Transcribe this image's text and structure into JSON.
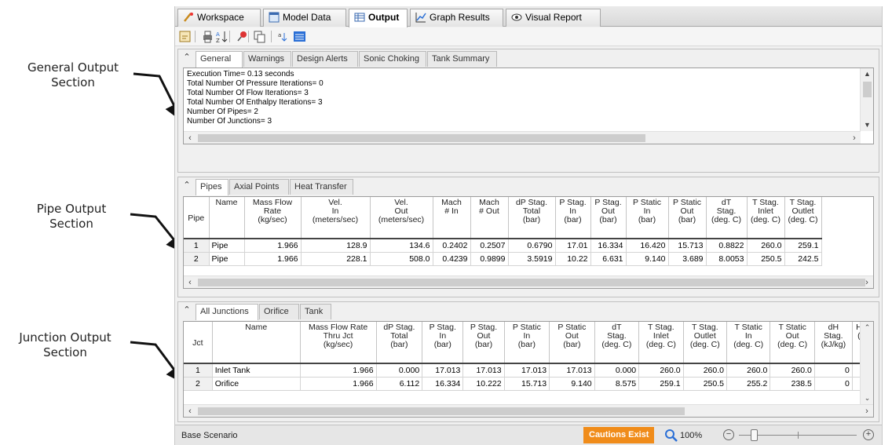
{
  "callouts": {
    "general": [
      "General Output",
      "Section"
    ],
    "pipe": [
      "Pipe Output",
      "Section"
    ],
    "junction": [
      "Junction Output",
      "Section"
    ]
  },
  "main_tabs": [
    "Workspace",
    "Model Data",
    "Output",
    "Graph Results",
    "Visual Report"
  ],
  "main_tab_icons": [
    "workspace-icon",
    "model-data-icon",
    "output-table-icon",
    "graph-results-icon",
    "visual-report-icon"
  ],
  "toolbar_icons": [
    "customize-icon",
    "print-icon",
    "sort-icon",
    "pin-icon",
    "copy-icon",
    "database-icon",
    "output-control-icon"
  ],
  "general": {
    "tabs": [
      "General",
      "Warnings",
      "Design Alerts",
      "Sonic Choking",
      "Tank Summary"
    ],
    "lines": [
      "Execution Time= 0.13 seconds",
      "Total Number Of Pressure Iterations= 0",
      "Total Number Of Flow Iterations= 3",
      "Total Number Of Enthalpy Iterations= 3",
      "Number Of Pipes= 2",
      "Number Of Junctions= 3"
    ]
  },
  "pipes": {
    "tabs": [
      "Pipes",
      "Axial Points",
      "Heat Transfer"
    ],
    "columns": [
      [
        "Pipe"
      ],
      [
        "Name"
      ],
      [
        "Mass Flow",
        "Rate",
        "(kg/sec)"
      ],
      [
        "Vel.",
        "In",
        "(meters/sec)"
      ],
      [
        "Vel.",
        "Out",
        "(meters/sec)"
      ],
      [
        "Mach",
        "# In"
      ],
      [
        "Mach",
        "# Out"
      ],
      [
        "dP Stag.",
        "Total",
        "(bar)"
      ],
      [
        "P Stag.",
        "In",
        "(bar)"
      ],
      [
        "P Stag.",
        "Out",
        "(bar)"
      ],
      [
        "P Static",
        "In",
        "(bar)"
      ],
      [
        "P Static",
        "Out",
        "(bar)"
      ],
      [
        "dT",
        "Stag.",
        "(deg. C)"
      ],
      [
        "T Stag.",
        "Inlet",
        "(deg. C)"
      ],
      [
        "T Stag.",
        "Outlet",
        "(deg. C)"
      ]
    ],
    "rows": [
      [
        "1",
        "Pipe",
        "1.966",
        "128.9",
        "134.6",
        "0.2402",
        "0.2507",
        "0.6790",
        "17.01",
        "16.334",
        "16.420",
        "15.713",
        "0.8822",
        "260.0",
        "259.1"
      ],
      [
        "2",
        "Pipe",
        "1.966",
        "228.1",
        "508.0",
        "0.4239",
        "0.9899",
        "3.5919",
        "10.22",
        "6.631",
        "9.140",
        "3.689",
        "8.0053",
        "250.5",
        "242.5"
      ]
    ]
  },
  "junctions": {
    "tabs": [
      "All Junctions",
      "Orifice",
      "Tank"
    ],
    "columns": [
      [
        "Jct"
      ],
      [
        "Name"
      ],
      [
        "Mass Flow Rate",
        "Thru Jct",
        "(kg/sec)"
      ],
      [
        "dP Stag.",
        "Total",
        "(bar)"
      ],
      [
        "P Stag.",
        "In",
        "(bar)"
      ],
      [
        "P Stag.",
        "Out",
        "(bar)"
      ],
      [
        "P Static",
        "In",
        "(bar)"
      ],
      [
        "P Static",
        "Out",
        "(bar)"
      ],
      [
        "dT",
        "Stag.",
        "(deg. C)"
      ],
      [
        "T Stag.",
        "Inlet",
        "(deg. C)"
      ],
      [
        "T Stag.",
        "Outlet",
        "(deg. C)"
      ],
      [
        "T Static",
        "In",
        "(deg. C)"
      ],
      [
        "T Static",
        "Out",
        "(deg. C)"
      ],
      [
        "dH",
        "Stag.",
        "(kJ/kg)"
      ],
      [
        "H",
        "("
      ]
    ],
    "rows": [
      [
        "1",
        "Inlet Tank",
        "1.966",
        "0.000",
        "17.013",
        "17.013",
        "17.013",
        "17.013",
        "0.000",
        "260.0",
        "260.0",
        "260.0",
        "260.0",
        "0",
        ""
      ],
      [
        "2",
        "Orifice",
        "1.966",
        "6.112",
        "16.334",
        "10.222",
        "15.713",
        "9.140",
        "8.575",
        "259.1",
        "250.5",
        "255.2",
        "238.5",
        "0",
        ""
      ]
    ]
  },
  "status": {
    "scenario": "Base Scenario",
    "cautions": "Cautions Exist",
    "zoom": "100%",
    "zoom_level": 0.1,
    "zoom_minus": "−",
    "zoom_plus": "+"
  },
  "colors": {
    "cautions": "#f08c1a",
    "accent": "#2a6fd6"
  }
}
